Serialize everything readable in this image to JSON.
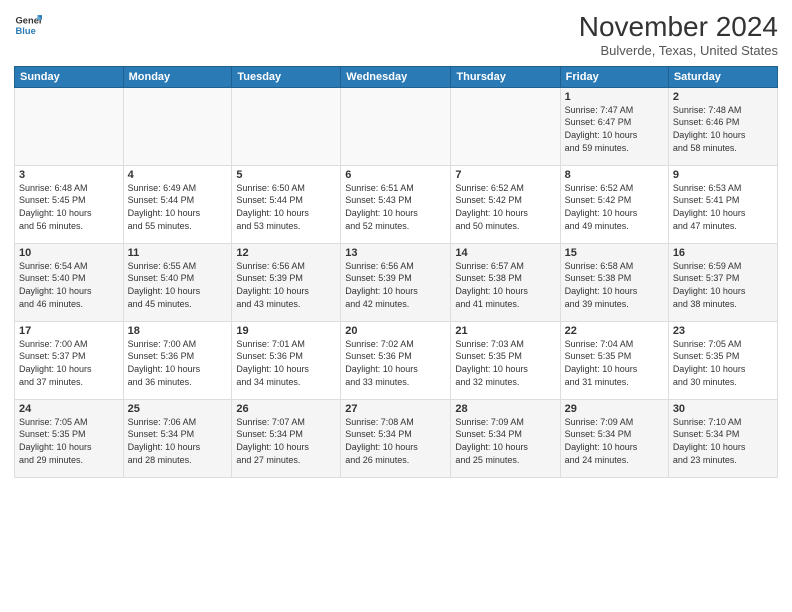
{
  "header": {
    "logo_line1": "General",
    "logo_line2": "Blue",
    "month": "November 2024",
    "location": "Bulverde, Texas, United States"
  },
  "weekdays": [
    "Sunday",
    "Monday",
    "Tuesday",
    "Wednesday",
    "Thursday",
    "Friday",
    "Saturday"
  ],
  "weeks": [
    [
      {
        "day": "",
        "info": ""
      },
      {
        "day": "",
        "info": ""
      },
      {
        "day": "",
        "info": ""
      },
      {
        "day": "",
        "info": ""
      },
      {
        "day": "",
        "info": ""
      },
      {
        "day": "1",
        "info": "Sunrise: 7:47 AM\nSunset: 6:47 PM\nDaylight: 10 hours\nand 59 minutes."
      },
      {
        "day": "2",
        "info": "Sunrise: 7:48 AM\nSunset: 6:46 PM\nDaylight: 10 hours\nand 58 minutes."
      }
    ],
    [
      {
        "day": "3",
        "info": "Sunrise: 6:48 AM\nSunset: 5:45 PM\nDaylight: 10 hours\nand 56 minutes."
      },
      {
        "day": "4",
        "info": "Sunrise: 6:49 AM\nSunset: 5:44 PM\nDaylight: 10 hours\nand 55 minutes."
      },
      {
        "day": "5",
        "info": "Sunrise: 6:50 AM\nSunset: 5:44 PM\nDaylight: 10 hours\nand 53 minutes."
      },
      {
        "day": "6",
        "info": "Sunrise: 6:51 AM\nSunset: 5:43 PM\nDaylight: 10 hours\nand 52 minutes."
      },
      {
        "day": "7",
        "info": "Sunrise: 6:52 AM\nSunset: 5:42 PM\nDaylight: 10 hours\nand 50 minutes."
      },
      {
        "day": "8",
        "info": "Sunrise: 6:52 AM\nSunset: 5:42 PM\nDaylight: 10 hours\nand 49 minutes."
      },
      {
        "day": "9",
        "info": "Sunrise: 6:53 AM\nSunset: 5:41 PM\nDaylight: 10 hours\nand 47 minutes."
      }
    ],
    [
      {
        "day": "10",
        "info": "Sunrise: 6:54 AM\nSunset: 5:40 PM\nDaylight: 10 hours\nand 46 minutes."
      },
      {
        "day": "11",
        "info": "Sunrise: 6:55 AM\nSunset: 5:40 PM\nDaylight: 10 hours\nand 45 minutes."
      },
      {
        "day": "12",
        "info": "Sunrise: 6:56 AM\nSunset: 5:39 PM\nDaylight: 10 hours\nand 43 minutes."
      },
      {
        "day": "13",
        "info": "Sunrise: 6:56 AM\nSunset: 5:39 PM\nDaylight: 10 hours\nand 42 minutes."
      },
      {
        "day": "14",
        "info": "Sunrise: 6:57 AM\nSunset: 5:38 PM\nDaylight: 10 hours\nand 41 minutes."
      },
      {
        "day": "15",
        "info": "Sunrise: 6:58 AM\nSunset: 5:38 PM\nDaylight: 10 hours\nand 39 minutes."
      },
      {
        "day": "16",
        "info": "Sunrise: 6:59 AM\nSunset: 5:37 PM\nDaylight: 10 hours\nand 38 minutes."
      }
    ],
    [
      {
        "day": "17",
        "info": "Sunrise: 7:00 AM\nSunset: 5:37 PM\nDaylight: 10 hours\nand 37 minutes."
      },
      {
        "day": "18",
        "info": "Sunrise: 7:00 AM\nSunset: 5:36 PM\nDaylight: 10 hours\nand 36 minutes."
      },
      {
        "day": "19",
        "info": "Sunrise: 7:01 AM\nSunset: 5:36 PM\nDaylight: 10 hours\nand 34 minutes."
      },
      {
        "day": "20",
        "info": "Sunrise: 7:02 AM\nSunset: 5:36 PM\nDaylight: 10 hours\nand 33 minutes."
      },
      {
        "day": "21",
        "info": "Sunrise: 7:03 AM\nSunset: 5:35 PM\nDaylight: 10 hours\nand 32 minutes."
      },
      {
        "day": "22",
        "info": "Sunrise: 7:04 AM\nSunset: 5:35 PM\nDaylight: 10 hours\nand 31 minutes."
      },
      {
        "day": "23",
        "info": "Sunrise: 7:05 AM\nSunset: 5:35 PM\nDaylight: 10 hours\nand 30 minutes."
      }
    ],
    [
      {
        "day": "24",
        "info": "Sunrise: 7:05 AM\nSunset: 5:35 PM\nDaylight: 10 hours\nand 29 minutes."
      },
      {
        "day": "25",
        "info": "Sunrise: 7:06 AM\nSunset: 5:34 PM\nDaylight: 10 hours\nand 28 minutes."
      },
      {
        "day": "26",
        "info": "Sunrise: 7:07 AM\nSunset: 5:34 PM\nDaylight: 10 hours\nand 27 minutes."
      },
      {
        "day": "27",
        "info": "Sunrise: 7:08 AM\nSunset: 5:34 PM\nDaylight: 10 hours\nand 26 minutes."
      },
      {
        "day": "28",
        "info": "Sunrise: 7:09 AM\nSunset: 5:34 PM\nDaylight: 10 hours\nand 25 minutes."
      },
      {
        "day": "29",
        "info": "Sunrise: 7:09 AM\nSunset: 5:34 PM\nDaylight: 10 hours\nand 24 minutes."
      },
      {
        "day": "30",
        "info": "Sunrise: 7:10 AM\nSunset: 5:34 PM\nDaylight: 10 hours\nand 23 minutes."
      }
    ]
  ]
}
